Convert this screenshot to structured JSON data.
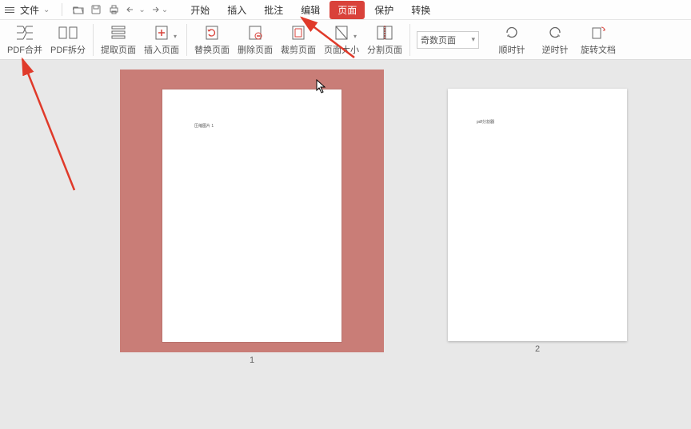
{
  "menubar": {
    "file_label": "文件",
    "tabs": [
      "开始",
      "插入",
      "批注",
      "编辑",
      "页面",
      "保护",
      "转换"
    ],
    "active_tab_index": 4
  },
  "ribbon": {
    "tools": [
      {
        "id": "pdf-merge",
        "label": "PDF合并"
      },
      {
        "id": "pdf-split",
        "label": "PDF拆分"
      },
      {
        "id": "extract-page",
        "label": "提取页面"
      },
      {
        "id": "insert-page",
        "label": "插入页面",
        "chev": true
      },
      {
        "id": "replace-page",
        "label": "替换页面"
      },
      {
        "id": "delete-page",
        "label": "删除页面"
      },
      {
        "id": "crop-page",
        "label": "裁剪页面"
      },
      {
        "id": "page-size",
        "label": "页面大小",
        "chev": true
      },
      {
        "id": "split-page",
        "label": "分割页面"
      }
    ],
    "layout_dropdown": "奇数页面",
    "rotate_tools": [
      {
        "id": "rotate-cw",
        "label": "顺时针"
      },
      {
        "id": "rotate-ccw",
        "label": "逆时针"
      },
      {
        "id": "rotate-doc",
        "label": "旋转文档"
      }
    ]
  },
  "pages": {
    "p1_text": "压缩图片 1",
    "p2_text": "pdf分割器",
    "p1_num": "1",
    "p2_num": "2"
  },
  "colors": {
    "accent": "#d9423a",
    "selection": "#c97d77",
    "arrow": "#e03a2a"
  }
}
